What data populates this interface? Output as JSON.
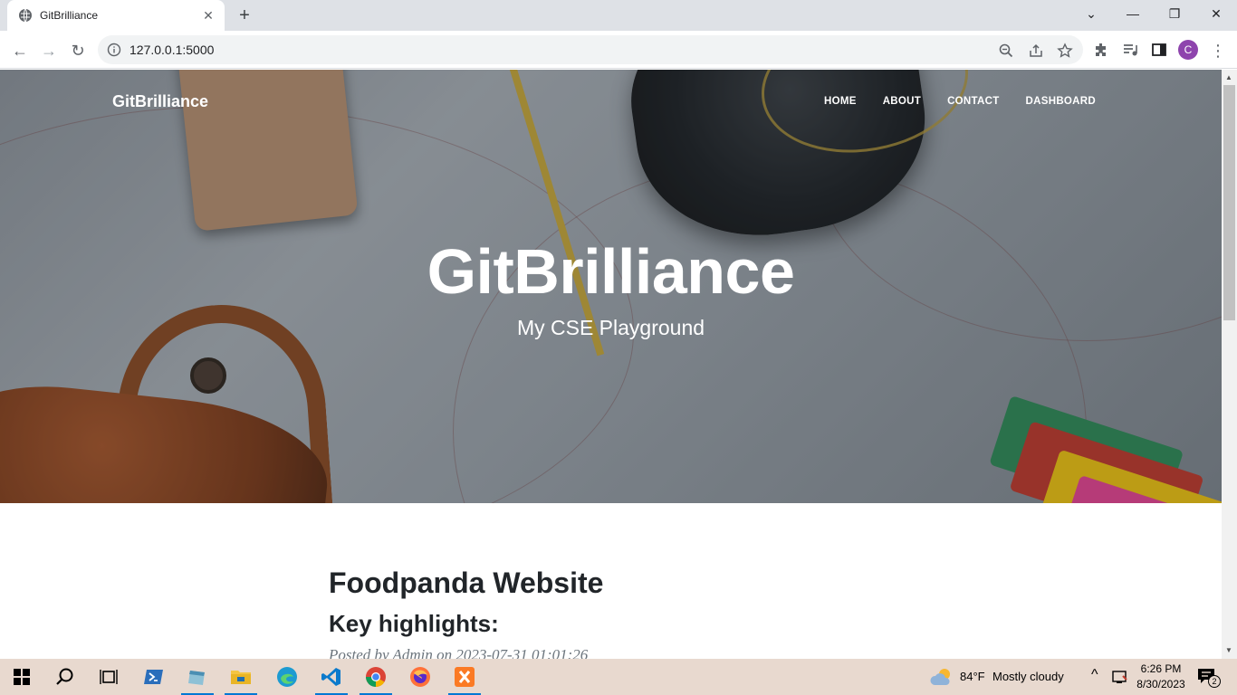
{
  "browser": {
    "tab_title": "GitBrilliance",
    "url": "127.0.0.1:5000",
    "profile_initial": "C"
  },
  "site": {
    "brand": "GitBrilliance",
    "nav": [
      "HOME",
      "ABOUT",
      "CONTACT",
      "DASHBOARD"
    ],
    "hero_title": "GitBrilliance",
    "hero_subtitle": "My CSE Playground"
  },
  "post": {
    "title": "Foodpanda Website",
    "subtitle": "Key highlights:",
    "meta": "Posted by Admin on 2023-07-31 01:01:26"
  },
  "taskbar": {
    "weather_temp": "84°F",
    "weather_desc": "Mostly cloudy",
    "time": "6:26 PM",
    "date": "8/30/2023",
    "notification_count": "2"
  },
  "colors": {
    "accent": "#0078d4",
    "taskbar_bg": "#e8d9cf",
    "profile": "#8e44ad"
  }
}
